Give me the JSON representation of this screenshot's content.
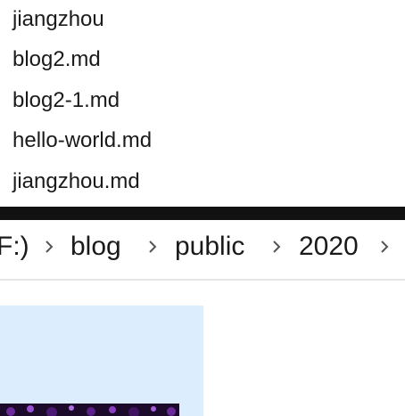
{
  "file_list": {
    "items": [
      {
        "label": "jiangzhou"
      },
      {
        "label": "blog2.md"
      },
      {
        "label": "blog2-1.md"
      },
      {
        "label": "hello-world.md"
      },
      {
        "label": "jiangzhou.md"
      }
    ]
  },
  "breadcrumb": {
    "items": [
      {
        "label": "F:)"
      },
      {
        "label": "blog"
      },
      {
        "label": "public"
      },
      {
        "label": "2020"
      }
    ],
    "separator_icon": "chevron-right-icon"
  },
  "colors": {
    "text": "#1a1a1a",
    "selected_tile": "#dceefd",
    "divider": "#111111",
    "thumbnail_bg": "#1b0a2a"
  }
}
